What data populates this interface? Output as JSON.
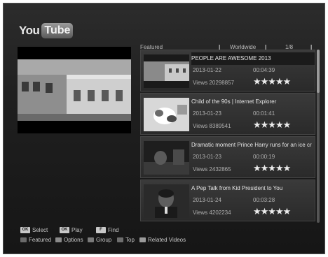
{
  "logo": {
    "you": "You",
    "tube": "Tube"
  },
  "header": {
    "feed": "Featured",
    "region": "Worldwide",
    "page": "1/8"
  },
  "videos": [
    {
      "title": "PEOPLE ARE AWESOME 2013",
      "date": "2013-01-22",
      "duration": "00:04:39",
      "views": "Views 20298857",
      "stars": "★★★★★",
      "thumb": "building-scene"
    },
    {
      "title": "Child of the 90s | Internet Explorer",
      "date": "2013-01-23",
      "duration": "00:01:41",
      "views": "Views 8389541",
      "stars": "★★★★★",
      "thumb": "snow-scene"
    },
    {
      "title": "Dramatic moment Prince Harry runs for an ice cr",
      "date": "2013-01-23",
      "duration": "00:00:19",
      "views": "Views 2432865",
      "stars": "★★★★★",
      "thumb": "dark-scene"
    },
    {
      "title": "A Pep Talk from Kid President to You",
      "date": "2013-01-24",
      "duration": "00:03:28",
      "views": "Views 4202234",
      "stars": "★★★★★",
      "thumb": "portrait-scene"
    }
  ],
  "footer": {
    "row1": [
      {
        "key": "OK",
        "label": "Select"
      },
      {
        "key": "OK",
        "label": "Play"
      },
      {
        "key": "F",
        "label": "Find"
      }
    ],
    "row2": [
      {
        "color": "#6a6a6a",
        "label": "Featured"
      },
      {
        "color": "#8a8a8a",
        "label": "Options"
      },
      {
        "color": "#7a7a7a",
        "label": "Group"
      },
      {
        "color": "#6e6e6e",
        "label": "Top"
      },
      {
        "color": "#9a9a9a",
        "label": "Related Videos"
      }
    ]
  },
  "colors": {
    "background": "#1f1f1f",
    "item": "#333333",
    "text": "#e6e6e6",
    "muted": "#b0b0b0"
  }
}
